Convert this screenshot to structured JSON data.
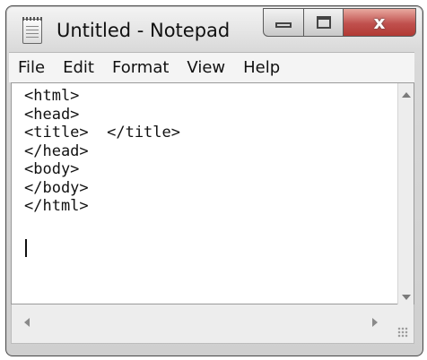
{
  "window": {
    "title": "Untitled - Notepad",
    "close_symbol": "x"
  },
  "menu": [
    "File",
    "Edit",
    "Format",
    "View",
    "Help"
  ],
  "editor": {
    "content": "<html>\n<head>\n<title>  </title>\n</head>\n<body>\n</body>\n</html>"
  },
  "icons": {
    "app": "notepad-icon",
    "minimize": "minimize-icon",
    "maximize": "maximize-icon",
    "close": "close-icon"
  },
  "colors": {
    "close_button": "#c0504d",
    "chrome": "#d9d9d9",
    "editor_bg": "#ffffff"
  }
}
